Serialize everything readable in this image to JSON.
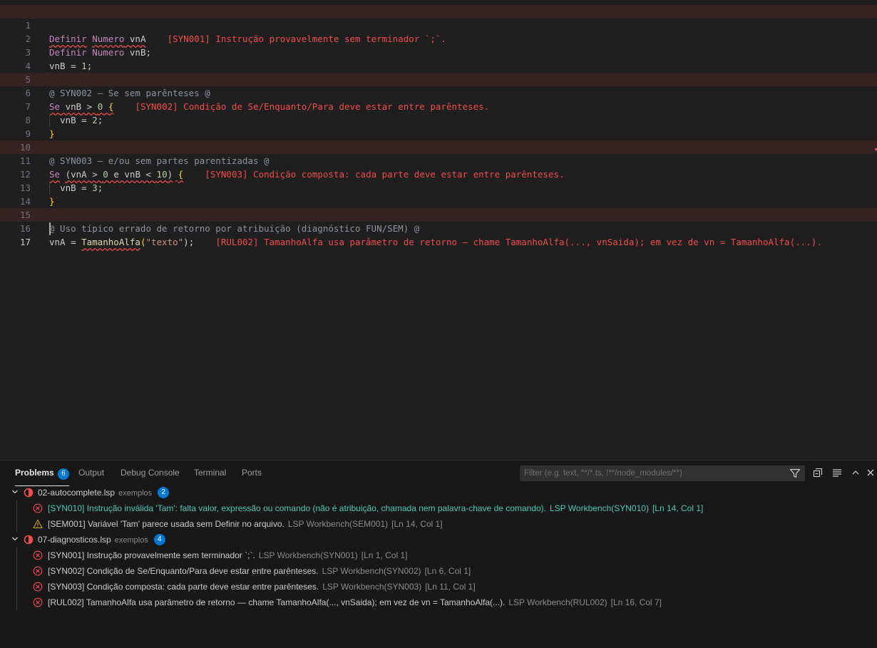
{
  "editor": {
    "lines": [
      {
        "n": "1"
      },
      {
        "n": "2"
      },
      {
        "n": "3"
      },
      {
        "n": "4"
      },
      {
        "n": "5"
      },
      {
        "n": "6"
      },
      {
        "n": "7"
      },
      {
        "n": "8"
      },
      {
        "n": "9"
      },
      {
        "n": "10"
      },
      {
        "n": "11"
      },
      {
        "n": "12"
      },
      {
        "n": "13"
      },
      {
        "n": "14"
      },
      {
        "n": "15"
      },
      {
        "n": "16"
      },
      {
        "n": "17"
      }
    ],
    "code": {
      "l1_kw": "Definir",
      "l1_type": "Numero",
      "l1_rest": " vnA",
      "l1_diag": "[SYN001] Instrução provavelmente sem terminador `;`.",
      "l2_kw": "Definir",
      "l2_type": "Numero",
      "l2_rest": " vnB;",
      "l3_a": "vnB = ",
      "l3_num": "1",
      "l3_end": ";",
      "l5_cmt": "@ SYN002 – Se sem parênteses @",
      "l6_kw": "Se",
      "l6_a": " vnB > ",
      "l6_num": "0",
      "l6_brace": "{",
      "l6_diag": "[SYN002] Condição de Se/Enquanto/Para deve estar entre parênteses.",
      "l7_a": "vnB = ",
      "l7_num": "2",
      "l7_end": ";",
      "l8_brace": "}",
      "l10_cmt": "@ SYN003 – e/ou sem partes parentizadas @",
      "l11_kw": "Se",
      "l11_a": "(vnA > ",
      "l11_num1": "0",
      "l11_b": " e vnB < ",
      "l11_num2": "10",
      "l11_c": ")",
      "l11_brace": "{",
      "l11_diag": "[SYN003] Condição composta: cada parte deve estar entre parênteses.",
      "l12_a": "vnB = ",
      "l12_num": "3",
      "l12_end": ";",
      "l13_brace": "}",
      "l15_cmt": "@ Uso típico errado de retorno por atribuição (diagnóstico FUN/SEM) @",
      "l16_a": "vnA = ",
      "l16_fn": "TamanhoAlfa",
      "l16_p1": "(",
      "l16_str": "\"texto\"",
      "l16_p2": ");",
      "l16_diag": "[RUL002] TamanhoAlfa usa parâmetro de retorno – chame TamanhoAlfa(..., vnSaida); em vez de vn = TamanhoAlfa(...)."
    }
  },
  "panel": {
    "tabs": {
      "problems": "Problems",
      "problems_count": "6",
      "output": "Output",
      "debug": "Debug Console",
      "terminal": "Terminal",
      "ports": "Ports"
    },
    "filter_placeholder": "Filter (e.g. text, **/*.ts, !**/node_modules/**)",
    "groups": [
      {
        "file": "02-autocomplete.lsp",
        "dir": "exemplos",
        "count": "2",
        "items": [
          {
            "sev": "error",
            "text": "[SYN010] Instrução inválida 'Tam': falta valor, expressão ou comando (não é atribuição, chamada nem palavra-chave de comando).",
            "src": "LSP Workbench(SYN010)",
            "loc": "[Ln 14, Col 1]"
          },
          {
            "sev": "warning",
            "text": "[SEM001] Variável 'Tam' parece usada sem Definir no arquivo.",
            "src": "LSP Workbench(SEM001)",
            "loc": "[Ln 14, Col 1]"
          }
        ]
      },
      {
        "file": "07-diagnosticos.lsp",
        "dir": "exemplos",
        "count": "4",
        "items": [
          {
            "sev": "error",
            "text": "[SYN001] Instrução provavelmente sem terminador `;`.",
            "src": "LSP Workbench(SYN001)",
            "loc": "[Ln 1, Col 1]"
          },
          {
            "sev": "error",
            "text": "[SYN002] Condição de Se/Enquanto/Para deve estar entre parênteses.",
            "src": "LSP Workbench(SYN002)",
            "loc": "[Ln 6, Col 1]"
          },
          {
            "sev": "error",
            "text": "[SYN003] Condição composta: cada parte deve estar entre parênteses.",
            "src": "LSP Workbench(SYN003)",
            "loc": "[Ln 11, Col 1]"
          },
          {
            "sev": "error",
            "text": "[RUL002] TamanhoAlfa usa parâmetro de retorno — chame TamanhoAlfa(..., vnSaida); em vez de vn = TamanhoAlfa(...).",
            "src": "LSP Workbench(RUL002)",
            "loc": "[Ln 16, Col 7]"
          }
        ]
      }
    ],
    "colors": {
      "error": "#f14c4c",
      "warning": "#cca700",
      "accent": "#0078d4",
      "selected": "#4ec9b0"
    }
  }
}
